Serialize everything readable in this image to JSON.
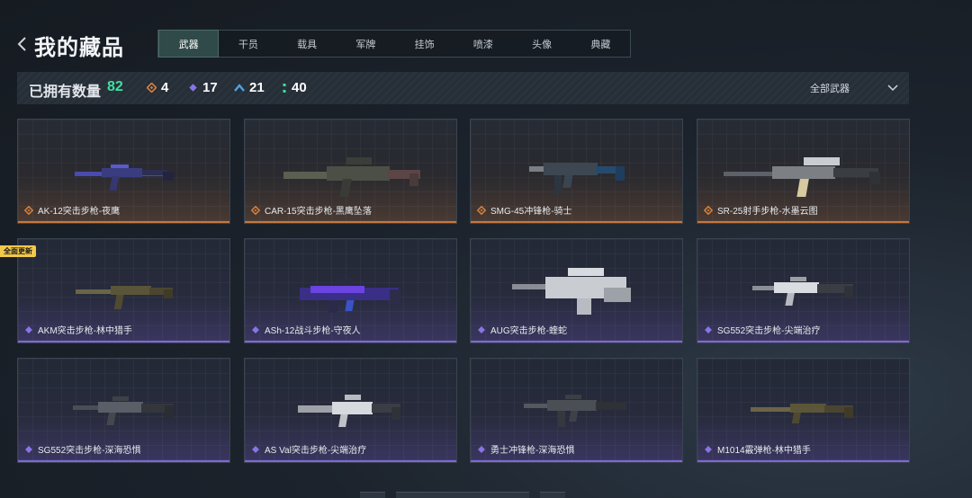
{
  "header": {
    "title": "我的藏品",
    "back_icon": "chevron-left-icon"
  },
  "tabs": [
    {
      "label": "武器",
      "active": true
    },
    {
      "label": "干员",
      "active": false
    },
    {
      "label": "载具",
      "active": false
    },
    {
      "label": "军牌",
      "active": false
    },
    {
      "label": "挂饰",
      "active": false
    },
    {
      "label": "喷漆",
      "active": false
    },
    {
      "label": "头像",
      "active": false
    },
    {
      "label": "典藏",
      "active": false
    }
  ],
  "stats": {
    "label": "已拥有数量",
    "count": "82",
    "rarities": [
      {
        "icon": "orange-diamond-icon",
        "value": "4",
        "color": "#d8823f"
      },
      {
        "icon": "purple-diamond-icon",
        "value": "17",
        "color": "#8a73e6"
      },
      {
        "icon": "blue-chevron-icon",
        "value": "21",
        "color": "#4ea3e0"
      },
      {
        "icon": "green-dots-icon",
        "value": "40",
        "color": "#3fe0a0"
      }
    ]
  },
  "filter": {
    "label": "全部武器",
    "icon": "chevron-down-icon"
  },
  "badge": {
    "label": "全面更新"
  },
  "colors": {
    "accent_green": "#3fe0a0",
    "legendary": "#d8823f",
    "epic": "#8a73e6"
  },
  "cards": [
    {
      "name": "AK-12突击步枪-夜鹰",
      "rarity": "orange"
    },
    {
      "name": "CAR-15突击步枪-黑鹰坠落",
      "rarity": "orange"
    },
    {
      "name": "SMG-45冲锋枪-骑士",
      "rarity": "orange"
    },
    {
      "name": "SR-25射手步枪-水墨云图",
      "rarity": "orange"
    },
    {
      "name": "AKM突击步枪-林中猎手",
      "rarity": "purple"
    },
    {
      "name": "ASh-12战斗步枪-守夜人",
      "rarity": "purple"
    },
    {
      "name": "AUG突击步枪-蝰蛇",
      "rarity": "purple"
    },
    {
      "name": "SG552突击步枪-尖端治疗",
      "rarity": "purple"
    },
    {
      "name": "SG552突击步枪-深海恐惧",
      "rarity": "purple"
    },
    {
      "name": "AS Val突击步枪-尖端治疗",
      "rarity": "purple"
    },
    {
      "name": "勇士冲锋枪-深海恐惧",
      "rarity": "purple"
    },
    {
      "name": "M1014霰弹枪-林中猎手",
      "rarity": "purple"
    }
  ]
}
